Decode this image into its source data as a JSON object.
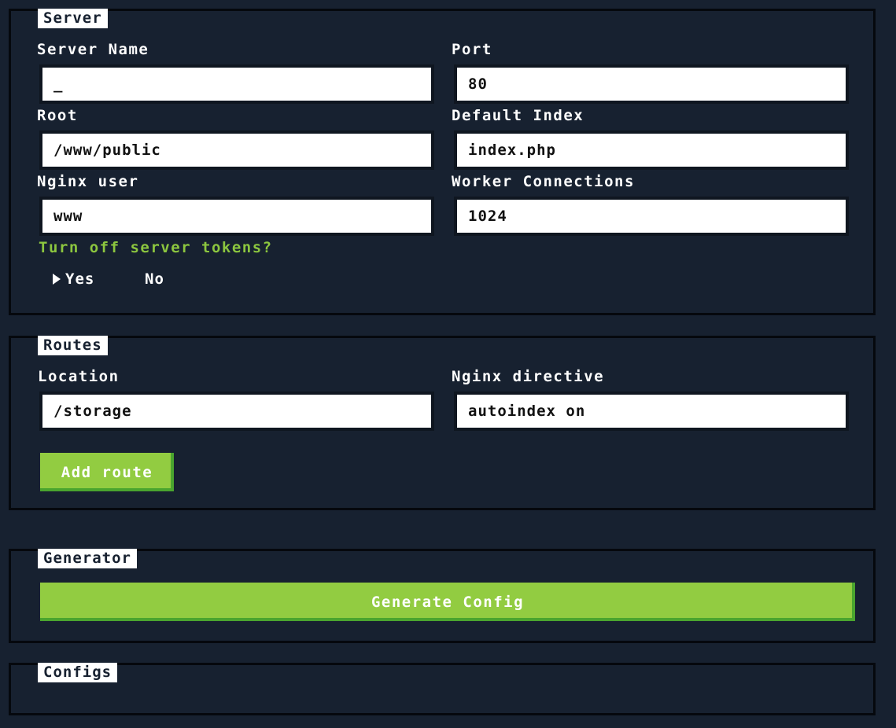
{
  "server": {
    "legend": "Server",
    "server_name_label": "Server Name",
    "server_name_value": "_",
    "port_label": "Port",
    "port_value": "80",
    "root_label": "Root",
    "root_value": "/www/public",
    "default_index_label": "Default Index",
    "default_index_value": "index.php",
    "nginx_user_label": "Nginx user",
    "nginx_user_value": "www",
    "worker_connections_label": "Worker Connections",
    "worker_connections_value": "1024",
    "tokens_question": "Turn off server tokens?",
    "option_yes": "Yes",
    "option_no": "No",
    "selected": "Yes"
  },
  "routes": {
    "legend": "Routes",
    "location_label": "Location",
    "location_value": "/storage",
    "directive_label": "Nginx directive",
    "directive_value": "autoindex on",
    "add_button": "Add route"
  },
  "generator": {
    "legend": "Generator",
    "generate_button": "Generate Config"
  },
  "configs": {
    "legend": "Configs"
  },
  "colors": {
    "background": "#172130",
    "accent_green": "#92cc41",
    "question_green": "#8cc63f",
    "field_white": "#ffffff"
  }
}
